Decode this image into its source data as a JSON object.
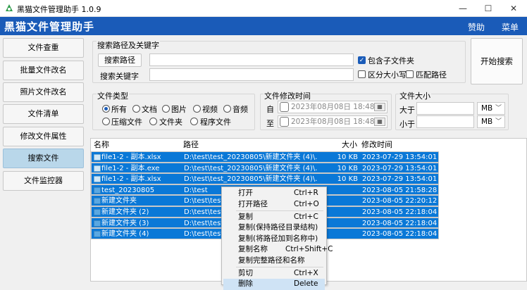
{
  "window": {
    "title": "黑猫文件管理助手 1.0.9",
    "controls": {
      "minimize": "—",
      "maximize": "☐",
      "close": "✕"
    }
  },
  "header": {
    "app_title": "黑猫文件管理助手",
    "menu": [
      "赞助",
      "菜单"
    ],
    "background_color": "#1a5bb8"
  },
  "sidebar": {
    "items": [
      {
        "label": "文件查重",
        "active": false
      },
      {
        "label": "批量文件改名",
        "active": false
      },
      {
        "label": "照片文件改名",
        "active": false
      },
      {
        "label": "文件清单",
        "active": false
      },
      {
        "label": "修改文件属性",
        "active": false
      },
      {
        "label": "搜索文件",
        "active": true
      },
      {
        "label": "文件监控器",
        "active": false
      }
    ]
  },
  "search": {
    "group_label": "搜索路径及关键字",
    "path_button": "搜索路径",
    "path_value": "",
    "keyword_label": "搜索关键字",
    "keyword_value": "",
    "include_subfolders": {
      "label": "包含子文件夹",
      "checked": true
    },
    "case_sensitive": {
      "label": "区分大小写",
      "checked": false
    },
    "match_path": {
      "label": "匹配路径",
      "checked": false
    },
    "start_button": "开始搜索"
  },
  "file_type": {
    "group_label": "文件类型",
    "options": [
      "所有",
      "文档",
      "图片",
      "视频",
      "音频",
      "压缩文件",
      "文件夹",
      "程序文件"
    ],
    "selected": "所有"
  },
  "mod_time": {
    "group_label": "文件修改时间",
    "from_label": "自",
    "from_value": "2023年08月08日  18:48",
    "to_label": "至",
    "to_value": "2023年08月08日  18:48"
  },
  "file_size": {
    "group_label": "文件大小",
    "greater_label": "大于",
    "greater_value": "",
    "greater_unit": "MB",
    "less_label": "小于",
    "less_value": "",
    "less_unit": "MB"
  },
  "file_list": {
    "columns": [
      "名称",
      "路径",
      "大小",
      "修改时间"
    ],
    "rows": [
      {
        "name": "file1-2 - 副本.xlsx",
        "path": "D:\\test\\test_20230805\\新建文件夹 (4)\\...",
        "size": "10 KB",
        "modified": "2023-07-29 13:54:01",
        "kind": "file"
      },
      {
        "name": "file1-2 - 副本.exe",
        "path": "D:\\test\\test_20230805\\新建文件夹 (4)\\...",
        "size": "10 KB",
        "modified": "2023-07-29 13:54:01",
        "kind": "file"
      },
      {
        "name": "file1-2 - 副本.xlsx",
        "path": "D:\\test\\test_20230805\\新建文件夹 (4)\\...",
        "size": "10 KB",
        "modified": "2023-07-29 13:54:01",
        "kind": "file"
      },
      {
        "name": "test_20230805",
        "path": "D:\\test",
        "size": "",
        "modified": "2023-08-05 21:58:28",
        "kind": "folder"
      },
      {
        "name": "新建文件夹",
        "path": "D:\\test\\test_2",
        "size": "",
        "modified": "2023-08-05 22:20:12",
        "kind": "folder"
      },
      {
        "name": "新建文件夹 (2)",
        "path": "D:\\test\\test_2",
        "size": "",
        "modified": "2023-08-05 22:18:04",
        "kind": "folder"
      },
      {
        "name": "新建文件夹 (3)",
        "path": "D:\\test\\test_2",
        "size": "",
        "modified": "2023-08-05 22:18:04",
        "kind": "folder"
      },
      {
        "name": "新建文件夹 (4)",
        "path": "D:\\test\\test_2",
        "size": "",
        "modified": "2023-08-05 22:18:04",
        "kind": "folder"
      }
    ]
  },
  "context_menu": {
    "items": [
      {
        "label": "打开",
        "shortcut": "Ctrl+R"
      },
      {
        "label": "打开路径",
        "shortcut": "Ctrl+O"
      },
      {
        "label": "复制",
        "shortcut": "Ctrl+C"
      },
      {
        "label": "复制(保持路径目录结构)",
        "shortcut": ""
      },
      {
        "label": "复制(将路径加到名称中)",
        "shortcut": ""
      },
      {
        "label": "复制名称",
        "shortcut": "Ctrl+Shift+C"
      },
      {
        "label": "复制完整路径和名称",
        "shortcut": ""
      },
      {
        "label": "剪切",
        "shortcut": "Ctrl+X"
      },
      {
        "label": "删除",
        "shortcut": "Delete"
      }
    ]
  },
  "colors": {
    "accent": "#1a5bb8",
    "selection": "#0a78d7",
    "sidebar_active": "#b9d7ea"
  }
}
